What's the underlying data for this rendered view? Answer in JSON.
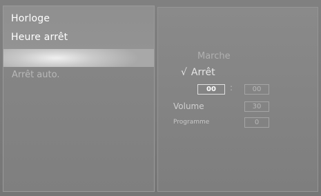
{
  "menu": {
    "items": [
      {
        "label": "Horloge"
      },
      {
        "label": "Heure arrêt"
      },
      {
        "label": "Arrêt auto."
      }
    ]
  },
  "options": {
    "marche_label": "Marche",
    "arret_label": "Arrêt",
    "arret_checked": true,
    "check_glyph": "√"
  },
  "time": {
    "hour": "00",
    "separator": ":",
    "minute": "00"
  },
  "volume": {
    "label": "Volume",
    "value": "30"
  },
  "programme": {
    "label": "Programme",
    "value": "0"
  },
  "icons": {
    "check": "check-icon"
  }
}
